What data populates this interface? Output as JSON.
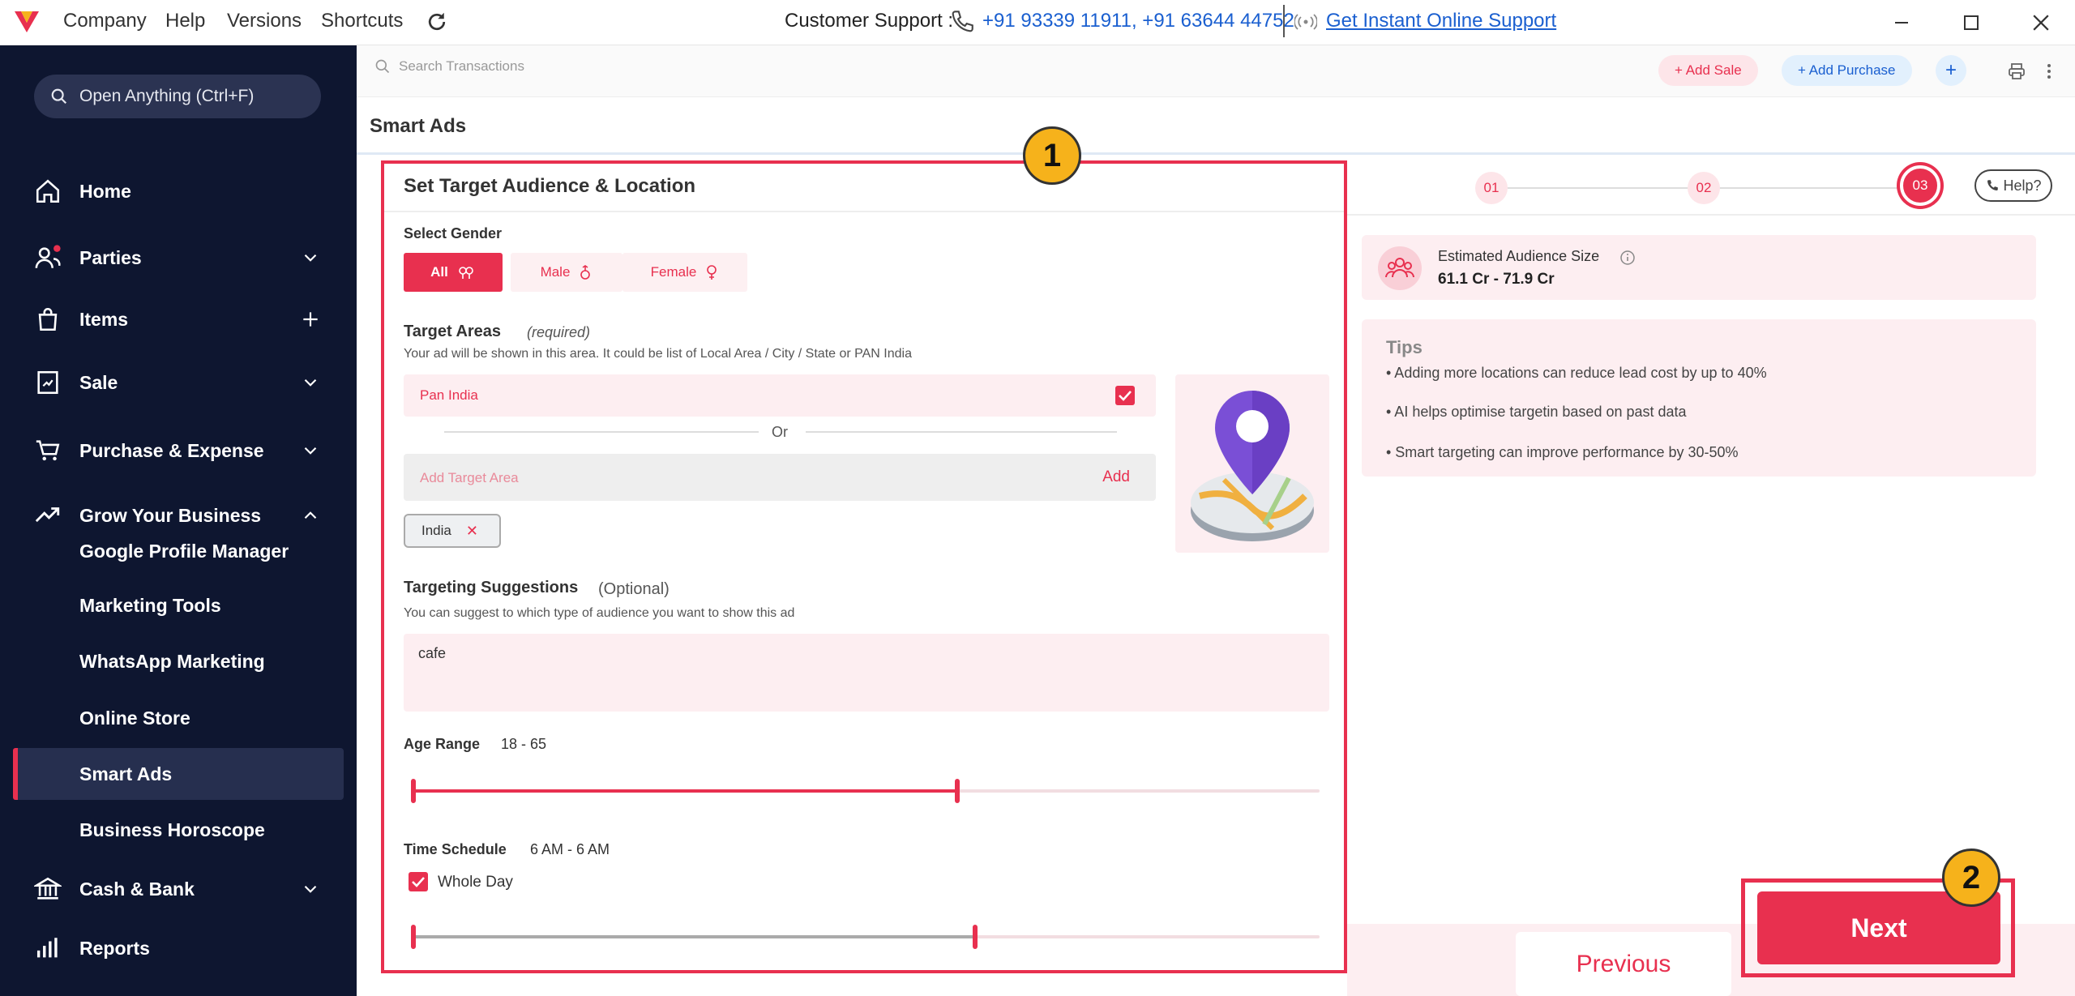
{
  "titlebar": {
    "menus": [
      "Company",
      "Help",
      "Versions",
      "Shortcuts"
    ],
    "support_label": "Customer Support :",
    "phone_numbers": "+91 93339 11911, +91 63644 44752",
    "instant_support": "Get Instant Online Support"
  },
  "sidebar": {
    "open_anything": "Open Anything (Ctrl+F)",
    "items": [
      {
        "label": "Home"
      },
      {
        "label": "Parties"
      },
      {
        "label": "Items"
      },
      {
        "label": "Sale"
      },
      {
        "label": "Purchase & Expense"
      },
      {
        "label": "Grow Your Business"
      },
      {
        "label": "Cash & Bank"
      },
      {
        "label": "Reports"
      }
    ],
    "sub_items": [
      {
        "label": "Google Profile Manager"
      },
      {
        "label": "Marketing Tools"
      },
      {
        "label": "WhatsApp Marketing"
      },
      {
        "label": "Online Store"
      },
      {
        "label": "Smart Ads"
      },
      {
        "label": "Business Horoscope"
      }
    ]
  },
  "toolbar": {
    "search_placeholder": "Search Transactions",
    "add_sale": "+ Add Sale",
    "add_purchase": "+ Add Purchase",
    "add_more": "+"
  },
  "page": {
    "title": "Smart Ads"
  },
  "form": {
    "title": "Set Target Audience & Location",
    "gender_label": "Select Gender",
    "gender_options": [
      "All",
      "Male",
      "Female"
    ],
    "gender_selected": "All",
    "target_areas_label": "Target Areas",
    "target_areas_required": "(required)",
    "target_areas_hint": "Your ad will be shown in this area. It could be list of Local Area / City / State or PAN India",
    "pan_india_label": "Pan India",
    "pan_india_checked": true,
    "or_text": "Or",
    "target_area_placeholder": "Add Target Area",
    "add_button": "Add",
    "chips": [
      "India"
    ],
    "suggestions_label": "Targeting Suggestions",
    "suggestions_optional": "(Optional)",
    "suggestions_hint": "You can suggest to which type of audience you want to show this ad",
    "suggestions_value": "cafe",
    "age_label": "Age Range",
    "age_value": "18 - 65",
    "age_fraction": 0.6,
    "time_label": "Time Schedule",
    "time_value": "6 AM - 6 AM",
    "whole_day_label": "Whole Day",
    "whole_day_checked": true,
    "time_fraction": 0.62
  },
  "steps": [
    "01",
    "02",
    "03"
  ],
  "active_step": "03",
  "help_label": "Help?",
  "audience": {
    "label": "Estimated Audience Size",
    "value": "61.1 Cr - 71.9 Cr"
  },
  "tips": {
    "title": "Tips",
    "items": [
      "• Adding more locations can reduce lead cost by up to 40%",
      "• AI helps optimise targetin based on past data",
      "• Smart targeting can improve performance by 30-50%"
    ]
  },
  "footer": {
    "previous": "Previous",
    "next": "Next"
  },
  "annotations": [
    "1",
    "2"
  ],
  "colors": {
    "accent": "#e8304f",
    "sidebar_bg": "#0e1630",
    "badge": "#f6b21b",
    "link": "#1a5fd0"
  }
}
